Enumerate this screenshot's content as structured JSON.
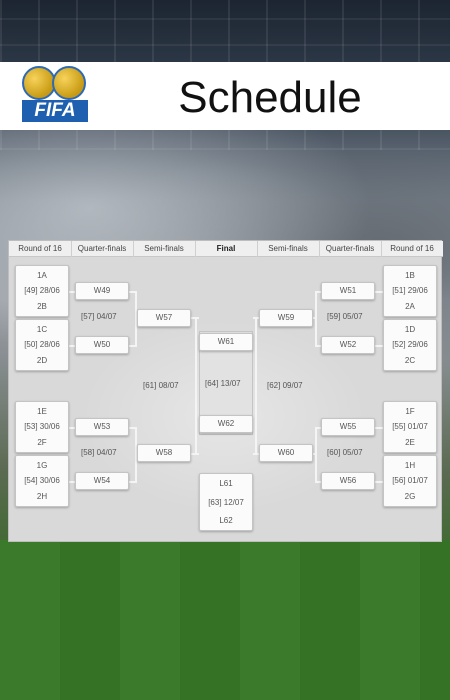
{
  "header": {
    "title": "Schedule",
    "logo_text": "FIFA"
  },
  "columns": [
    "Round of 16",
    "Quarter-finals",
    "Semi-finals",
    "Final",
    "Semi-finals",
    "Quarter-finals",
    "Round of 16"
  ],
  "round_of_16": {
    "m49": {
      "team1": "1A",
      "info": "[49] 28/06",
      "team2": "2B"
    },
    "m50": {
      "team1": "1C",
      "info": "[50] 28/06",
      "team2": "2D"
    },
    "m53": {
      "team1": "1E",
      "info": "[53] 30/06",
      "team2": "2F"
    },
    "m54": {
      "team1": "1G",
      "info": "[54] 30/06",
      "team2": "2H"
    },
    "m51": {
      "team1": "1B",
      "info": "[51] 29/06",
      "team2": "2A"
    },
    "m52": {
      "team1": "1D",
      "info": "[52] 29/06",
      "team2": "2C"
    },
    "m55": {
      "team1": "1F",
      "info": "[55] 01/07",
      "team2": "2E"
    },
    "m56": {
      "team1": "1H",
      "info": "[56] 01/07",
      "team2": "2G"
    }
  },
  "quarter_finals": {
    "w49": "W49",
    "w50": "W50",
    "m57": "[57] 04/07",
    "w53": "W53",
    "w54": "W54",
    "m58": "[58] 04/07",
    "w51": "W51",
    "w52": "W52",
    "m59": "[59] 05/07",
    "w55": "W55",
    "w56": "W56",
    "m60": "[60] 05/07"
  },
  "semi_finals": {
    "w57": "W57",
    "w58": "W58",
    "m61": "[61] 08/07",
    "w59": "W59",
    "w60": "W60",
    "m62": "[62] 09/07"
  },
  "final": {
    "w61": "W61",
    "w62": "W62",
    "m64": "[64] 13/07"
  },
  "third_place": {
    "l61": "L61",
    "l62": "L62",
    "m63": "[63] 12/07"
  }
}
